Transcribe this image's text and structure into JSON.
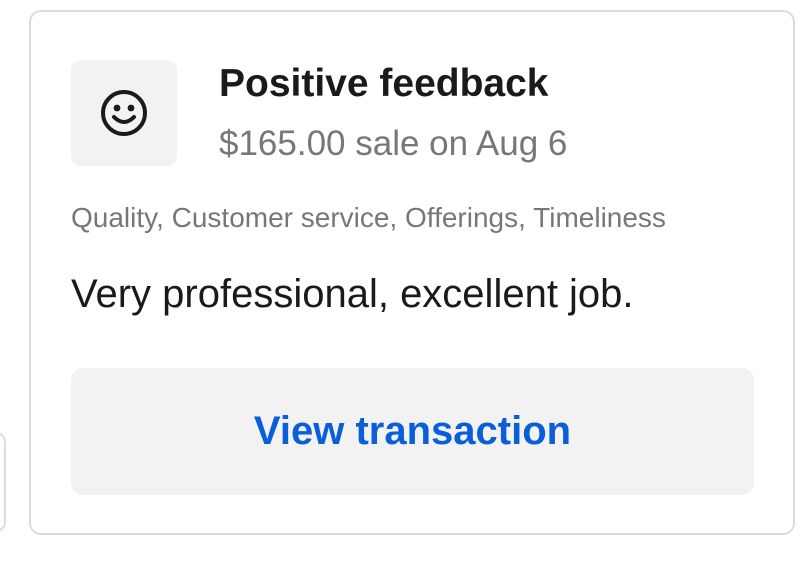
{
  "feedback": {
    "icon": "smiley-face-icon",
    "title": "Positive feedback",
    "subtitle": "$165.00 sale on Aug 6",
    "tags": "Quality, Customer service, Offerings, Timeliness",
    "comment": "Very professional, excellent job.",
    "action_label": "View transaction"
  },
  "colors": {
    "title": "#1a1a1a",
    "secondary_text": "#777777",
    "tile_background": "#f2f2f2",
    "card_border": "#dcdcdc",
    "link_blue": "#0a5ed8"
  }
}
